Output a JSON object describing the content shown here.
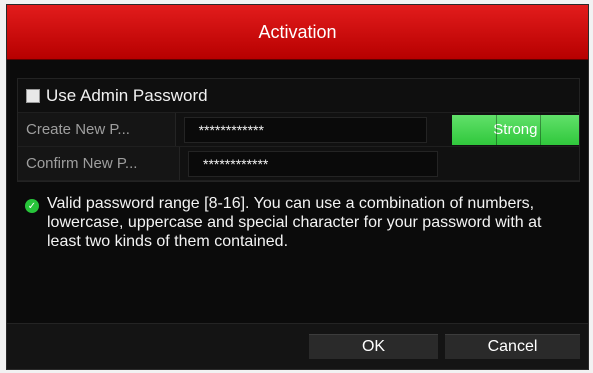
{
  "dialog": {
    "title": "Activation"
  },
  "admin_password": {
    "label": "Use Admin Password",
    "checked": false
  },
  "fields": [
    {
      "label": "Create New P...",
      "value": "************"
    },
    {
      "label": "Confirm New P...",
      "value": "************"
    }
  ],
  "password_strength": "Strong",
  "info": {
    "icon": "check-circle-icon",
    "text": "Valid password range [8-16]. You can use a combination of numbers, lowercase, uppercase and special character for your password with at least two kinds of them contained."
  },
  "buttons": {
    "ok": "OK",
    "cancel": "Cancel"
  },
  "colors": {
    "title_bar": "#d60000",
    "strength": "#39c845",
    "valid_icon": "#27c53a"
  }
}
